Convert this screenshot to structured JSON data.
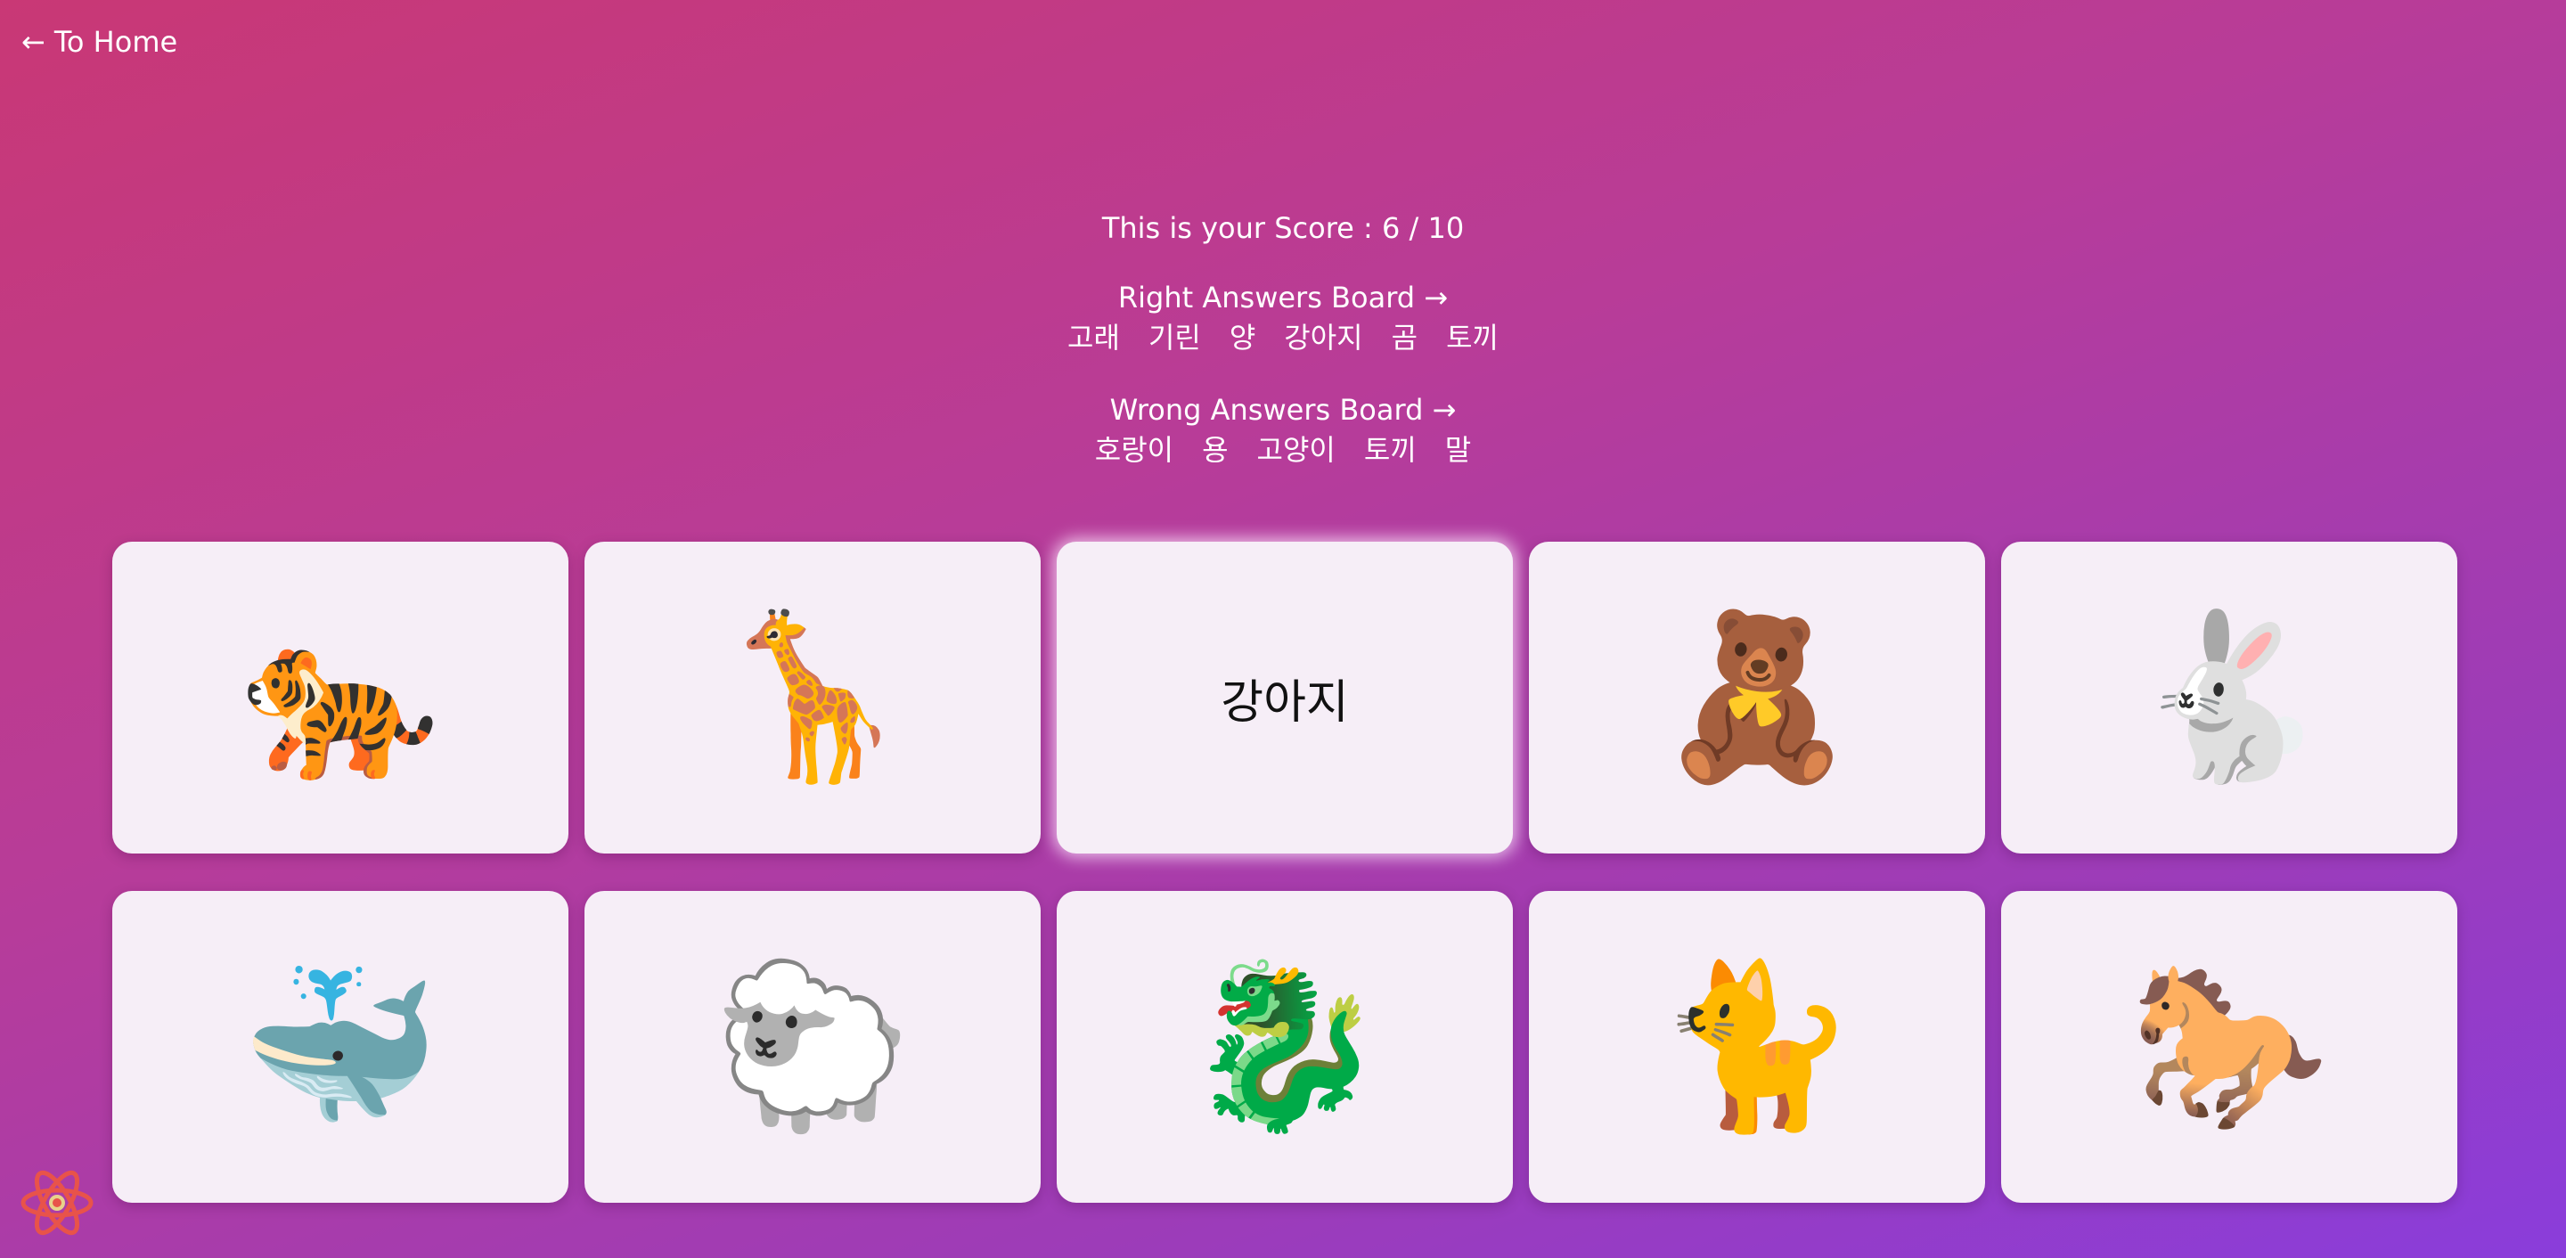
{
  "nav": {
    "home_arrow": "←",
    "home_label": "To Home"
  },
  "score": {
    "label": "This is your Score : 6 / 10"
  },
  "right_board": {
    "title": "Right Answers Board →",
    "words": [
      "고래",
      "기린",
      "양",
      "강아지",
      "곰",
      "토끼"
    ]
  },
  "wrong_board": {
    "title": "Wrong Answers Board →",
    "words": [
      "호랑이",
      "용",
      "고양이",
      "토끼",
      "말"
    ]
  },
  "cards": [
    {
      "content": "🐅",
      "kind": "emoji",
      "icon": "tiger-icon"
    },
    {
      "content": "🦒",
      "kind": "emoji",
      "icon": "giraffe-icon"
    },
    {
      "content": "강아지",
      "kind": "word",
      "icon": ""
    },
    {
      "content": "🧸",
      "kind": "emoji",
      "icon": "teddy-bear-icon"
    },
    {
      "content": "🐇",
      "kind": "emoji",
      "icon": "rabbit-icon"
    },
    {
      "content": "🐳",
      "kind": "emoji",
      "icon": "whale-icon"
    },
    {
      "content": "🐑",
      "kind": "emoji",
      "icon": "sheep-icon"
    },
    {
      "content": "🐉",
      "kind": "emoji",
      "icon": "dragon-icon"
    },
    {
      "content": "🐈",
      "kind": "emoji",
      "icon": "cat-icon"
    },
    {
      "content": "🐎",
      "kind": "emoji",
      "icon": "horse-icon"
    }
  ],
  "colors": {
    "accent": "#b83c98",
    "card": "#f6eef7",
    "logo": "#e8534a"
  }
}
